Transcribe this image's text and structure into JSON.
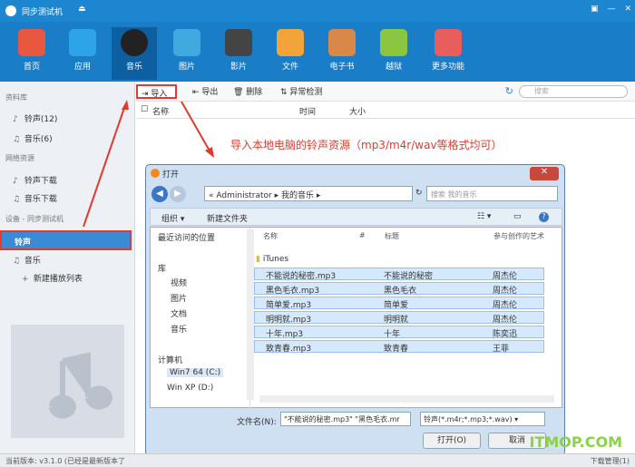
{
  "titlebar": {
    "app_name": "同步测试机",
    "eject": "⏏",
    "btn_a": "▣",
    "btn_min": "—",
    "btn_close": "✕"
  },
  "toolbar": {
    "items": [
      {
        "label": "首页",
        "color": "#e8573f"
      },
      {
        "label": "应用",
        "color": "#2ea4e8"
      },
      {
        "label": "音乐",
        "color": "#222222"
      },
      {
        "label": "图片",
        "color": "#3fa9e0"
      },
      {
        "label": "影片",
        "color": "#444444"
      },
      {
        "label": "文件",
        "color": "#f2a33a"
      },
      {
        "label": "电子书",
        "color": "#d9884a"
      },
      {
        "label": "越狱",
        "color": "#8cc63f"
      },
      {
        "label": "更多功能",
        "color": "#e95d5d"
      }
    ]
  },
  "sidebar": {
    "section1": "资料库",
    "ringtones": "铃声(12)",
    "music": "音乐(6)",
    "section2": "网络资源",
    "ringtone_dl": "铃声下载",
    "music_dl": "音乐下载",
    "section3": "设备 - 同步测试机",
    "dev_ringtone": "铃声",
    "dev_music": "音乐",
    "new_playlist": "新建播放列表"
  },
  "main": {
    "import": "导入",
    "export": "导出",
    "delete": "删除",
    "anomaly": "异常检测",
    "search_placeholder": "搜索",
    "col_name": "名称",
    "col_time": "时间",
    "col_size": "大小"
  },
  "annotation": "导入本地电脑的铃声资源（mp3/m4r/wav等格式均可）",
  "dialog": {
    "title": "打开",
    "path_prefix": "«",
    "path1": "Administrator",
    "path2": "我的音乐",
    "search_placeholder": "搜索 我的音乐",
    "organize": "组织 ▾",
    "new_folder": "新建文件夹",
    "nav": [
      "最近访问的位置",
      "库",
      "视频",
      "图片",
      "文档",
      "音乐",
      "计算机",
      "Win7 64 (C:)",
      "Win XP (D:)"
    ],
    "headers": {
      "name": "名称",
      "num": "#",
      "title": "标题",
      "artist": "参与创作的艺术"
    },
    "folder": "iTunes",
    "files": [
      {
        "name": "不能说的秘密.mp3",
        "title": "不能说的秘密",
        "artist": "周杰伦"
      },
      {
        "name": "黑色毛衣.mp3",
        "title": "黑色毛衣",
        "artist": "周杰伦"
      },
      {
        "name": "简单爱.mp3",
        "title": "简单爱",
        "artist": "周杰伦"
      },
      {
        "name": "明明就.mp3",
        "title": "明明就",
        "artist": "周杰伦"
      },
      {
        "name": "十年.mp3",
        "title": "十年",
        "artist": "陈奕迅"
      },
      {
        "name": "致青春.mp3",
        "title": "致青春",
        "artist": "王菲"
      }
    ],
    "filename_label": "文件名(N):",
    "filename_value": "\"不能说的秘密.mp3\" \"黑色毛衣.mr",
    "filetype": "铃声(*.m4r;*.mp3;*.wav)",
    "open": "打开(O)",
    "cancel": "取消"
  },
  "status": {
    "version": "当前版本: v3.1.0   (已经是最新版本了",
    "download": "下载管理(1)"
  },
  "watermark": "ITMOP.COM"
}
